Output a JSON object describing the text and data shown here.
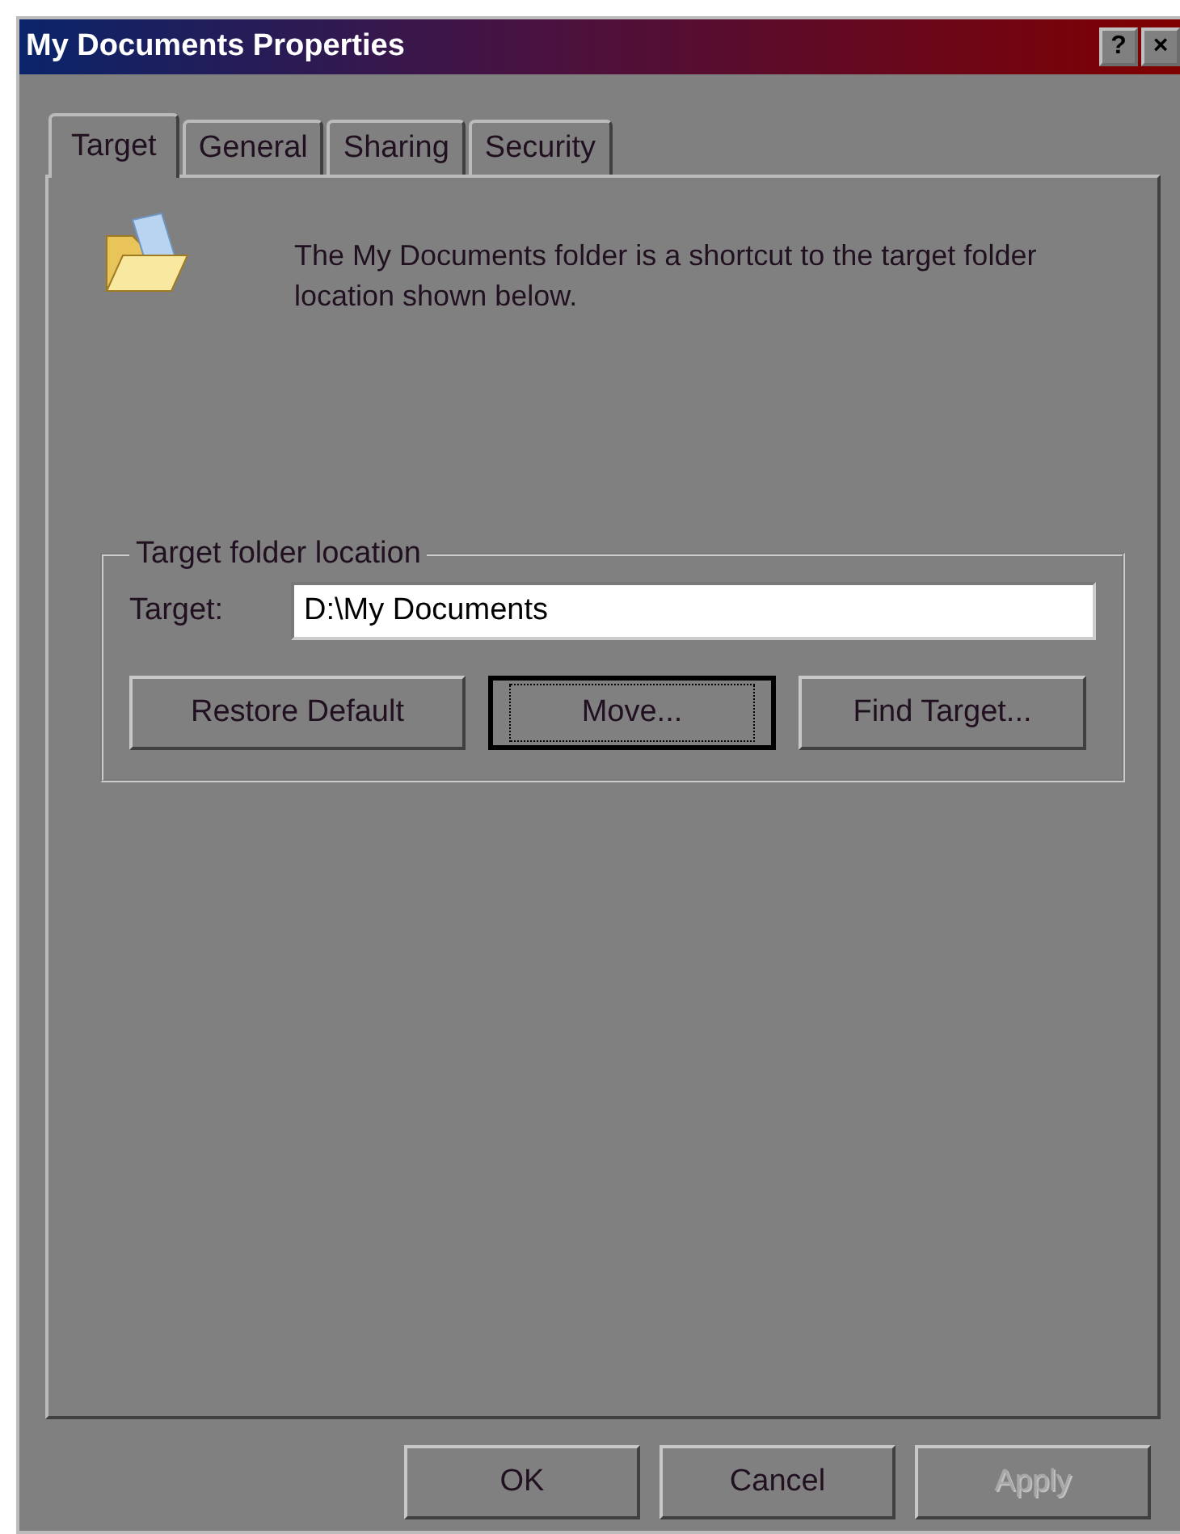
{
  "window": {
    "title": "My Documents Properties",
    "title_buttons": [
      "?",
      "×"
    ]
  },
  "tabs": [
    {
      "label": "Target",
      "selected": true
    },
    {
      "label": "General",
      "selected": false
    },
    {
      "label": "Sharing",
      "selected": false
    },
    {
      "label": "Security",
      "selected": false
    }
  ],
  "description": "The My Documents folder is a shortcut to the target folder location shown below.",
  "group": {
    "title": "Target folder location",
    "field_label": "Target:",
    "field_value": "D:\\My Documents",
    "buttons": [
      {
        "label": "Restore Default",
        "focused": false
      },
      {
        "label": "Move...",
        "focused": true
      },
      {
        "label": "Find Target...",
        "focused": false
      }
    ]
  },
  "dialog_buttons": [
    {
      "label": "OK",
      "disabled": false
    },
    {
      "label": "Cancel",
      "disabled": false
    },
    {
      "label": "Apply",
      "disabled": true
    }
  ]
}
